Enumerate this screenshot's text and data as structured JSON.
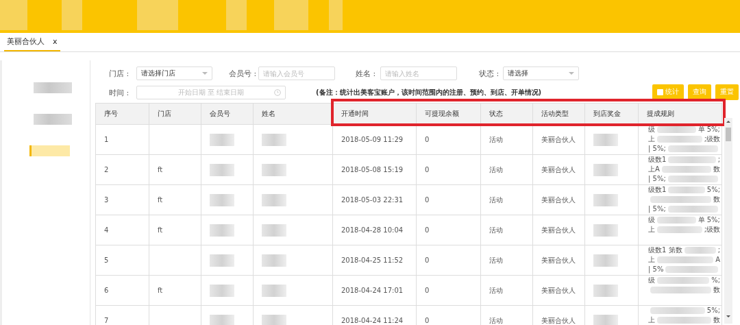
{
  "tabs": [
    {
      "label": "美丽合伙人",
      "close": "x",
      "selected": true
    }
  ],
  "sidebar": {
    "items": [
      {
        "selected": false
      },
      {
        "selected": false
      },
      {
        "selected": true
      }
    ]
  },
  "filters": {
    "store": {
      "label": "门店 :",
      "value": "请选择门店"
    },
    "member_no": {
      "label": "会员号 :",
      "placeholder": "请输入会员号"
    },
    "name": {
      "label": "姓名 :",
      "placeholder": "请输入姓名"
    },
    "status": {
      "label": "状态 :",
      "value": "请选择"
    },
    "time": {
      "label": "时间 :",
      "placeholder": "开始日期 至 结束日期"
    },
    "note": "(备注：统计出美客宝账户，该时间范围内的注册、预约、到店、开单情况)"
  },
  "buttons": [
    {
      "label": "统计",
      "kind": "check"
    },
    {
      "label": "查询",
      "kind": "plain"
    },
    {
      "label": "重置",
      "kind": "plain"
    }
  ],
  "table": {
    "columns": [
      {
        "label": "序号",
        "highlighted": false
      },
      {
        "label": "门店",
        "highlighted": false
      },
      {
        "label": "会员号",
        "highlighted": false
      },
      {
        "label": "姓名",
        "highlighted": false
      },
      {
        "label": "开通时间",
        "highlighted": true
      },
      {
        "label": "可提现余额",
        "highlighted": true
      },
      {
        "label": "状态",
        "highlighted": true
      },
      {
        "label": "活动类型",
        "highlighted": true
      },
      {
        "label": "到店奖金",
        "highlighted": true
      },
      {
        "label": "提成规则",
        "highlighted": true
      }
    ],
    "rows": [
      {
        "no": "1",
        "store": "",
        "opened": "2018-05-09 11:29",
        "balance": "0",
        "status": "活动",
        "type": "美丽合伙人",
        "rule": [
          {
            "start": "级",
            "end": "单 5%;"
          },
          {
            "start": "上",
            "end": ";级数"
          },
          {
            "start": "| 5%;"
          }
        ]
      },
      {
        "no": "2",
        "store": "ft",
        "opened": "2018-05-08 15:19",
        "balance": "0",
        "status": "活动",
        "type": "美丽合伙人",
        "rule": [
          {
            "start": "级数1",
            "end": ";"
          },
          {
            "start": "上A",
            "end": "数"
          },
          {
            "start": "| 5%;"
          }
        ]
      },
      {
        "no": "3",
        "store": "ft",
        "opened": "2018-05-03 22:31",
        "balance": "0",
        "status": "活动",
        "type": "美丽合伙人",
        "rule": [
          {
            "start": "级数1",
            "end": "5%;"
          },
          {
            "end": "数"
          },
          {
            "start": "| 5%;"
          }
        ]
      },
      {
        "no": "4",
        "store": "ft",
        "opened": "2018-04-28 10:04",
        "balance": "0",
        "status": "活动",
        "type": "美丽合伙人",
        "rule": [
          {
            "start": "级",
            "end": "单 5%;"
          },
          {
            "start": "上",
            "end": ";级数"
          }
        ]
      },
      {
        "no": "5",
        "store": "",
        "opened": "2018-04-25 11:52",
        "balance": "0",
        "status": "活动",
        "type": "美丽合伙人",
        "rule": [
          {
            "start": "级数1 第数",
            "end": ";"
          },
          {
            "start": "上",
            "end": "A"
          },
          {
            "start": "| 5%"
          }
        ]
      },
      {
        "no": "6",
        "store": "ft",
        "opened": "2018-04-24 17:01",
        "balance": "0",
        "status": "活动",
        "type": "美丽合伙人",
        "rule": [
          {
            "start": "级",
            "end": "%;"
          },
          {
            "end": "数"
          }
        ]
      },
      {
        "no": "7",
        "store": "",
        "opened": "2018-04-24 11:24",
        "balance": "0",
        "status": "活动",
        "type": "美丽合伙人",
        "rule": [
          {
            "end": "5%;"
          },
          {
            "start": "上",
            "end": "数"
          }
        ]
      }
    ]
  }
}
